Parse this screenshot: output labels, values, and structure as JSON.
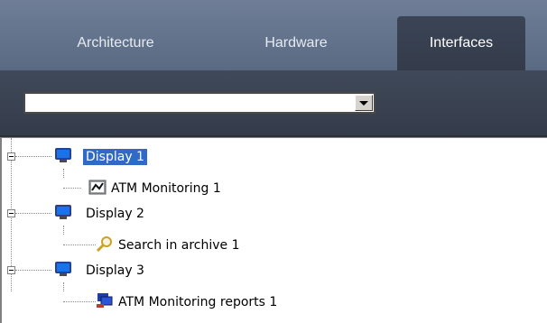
{
  "tabs": [
    {
      "label": "Architecture",
      "active": false
    },
    {
      "label": "Hardware",
      "active": false
    },
    {
      "label": "Interfaces",
      "active": true
    }
  ],
  "dropdown": {
    "value": ""
  },
  "tree": [
    {
      "label": "Display 1",
      "selected": true,
      "icon": "monitor-icon",
      "children": [
        {
          "label": "ATM Monitoring 1",
          "icon": "atm-monitoring-icon"
        }
      ]
    },
    {
      "label": "Display 2",
      "selected": false,
      "icon": "monitor-icon",
      "children": [
        {
          "label": "Search in archive 1",
          "icon": "search-archive-icon"
        }
      ]
    },
    {
      "label": "Display 3",
      "selected": false,
      "icon": "monitor-icon",
      "children": [
        {
          "label": "ATM Monitoring reports 1",
          "icon": "atm-reports-icon"
        }
      ]
    }
  ],
  "colors": {
    "tabbar": "#6a7990",
    "toolbar": "#3b4455",
    "selection": "#316ac5"
  }
}
